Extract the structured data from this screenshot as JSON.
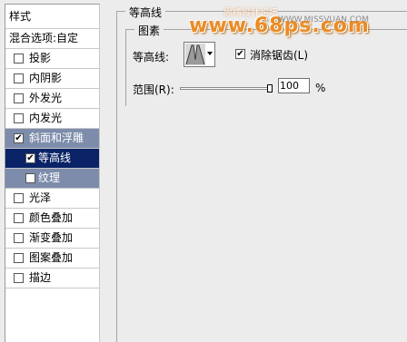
{
  "styles_panel": {
    "title": "样式",
    "blending_options": "混合选项:自定",
    "items": [
      {
        "label": "投影",
        "checked": false
      },
      {
        "label": "内阴影",
        "checked": false
      },
      {
        "label": "外发光",
        "checked": false
      },
      {
        "label": "内发光",
        "checked": false
      },
      {
        "label": "斜面和浮雕",
        "checked": true
      },
      {
        "label": "等高线",
        "checked": true
      },
      {
        "label": "纹理",
        "checked": false
      },
      {
        "label": "光泽",
        "checked": false
      },
      {
        "label": "颜色叠加",
        "checked": false
      },
      {
        "label": "渐变叠加",
        "checked": false
      },
      {
        "label": "图案叠加",
        "checked": false
      },
      {
        "label": "描边",
        "checked": false
      }
    ]
  },
  "contour": {
    "group_title": "等高线",
    "elements_title": "图素",
    "contour_label": "等高线:",
    "antialias_label": "消除锯齿(L)",
    "antialias_checked": true,
    "range_label": "范围(R):",
    "range_value": "100",
    "range_unit": "%",
    "range_fraction": 1.0
  },
  "watermark": {
    "site": "www.68ps.com",
    "cn_text": "思缘设计论坛",
    "url": "WWW.MISSVUAN.COM"
  },
  "colors": {
    "selected_bg": "#7d8cab",
    "active_bg": "#0a2366",
    "watermark_orange": "#ea8b24"
  },
  "icons": {
    "checkbox_checked": "check-mark",
    "contour_preview": "contour-curve-icon",
    "dropdown": "chevron-down-icon",
    "slider_thumb": "slider-thumb-icon"
  }
}
